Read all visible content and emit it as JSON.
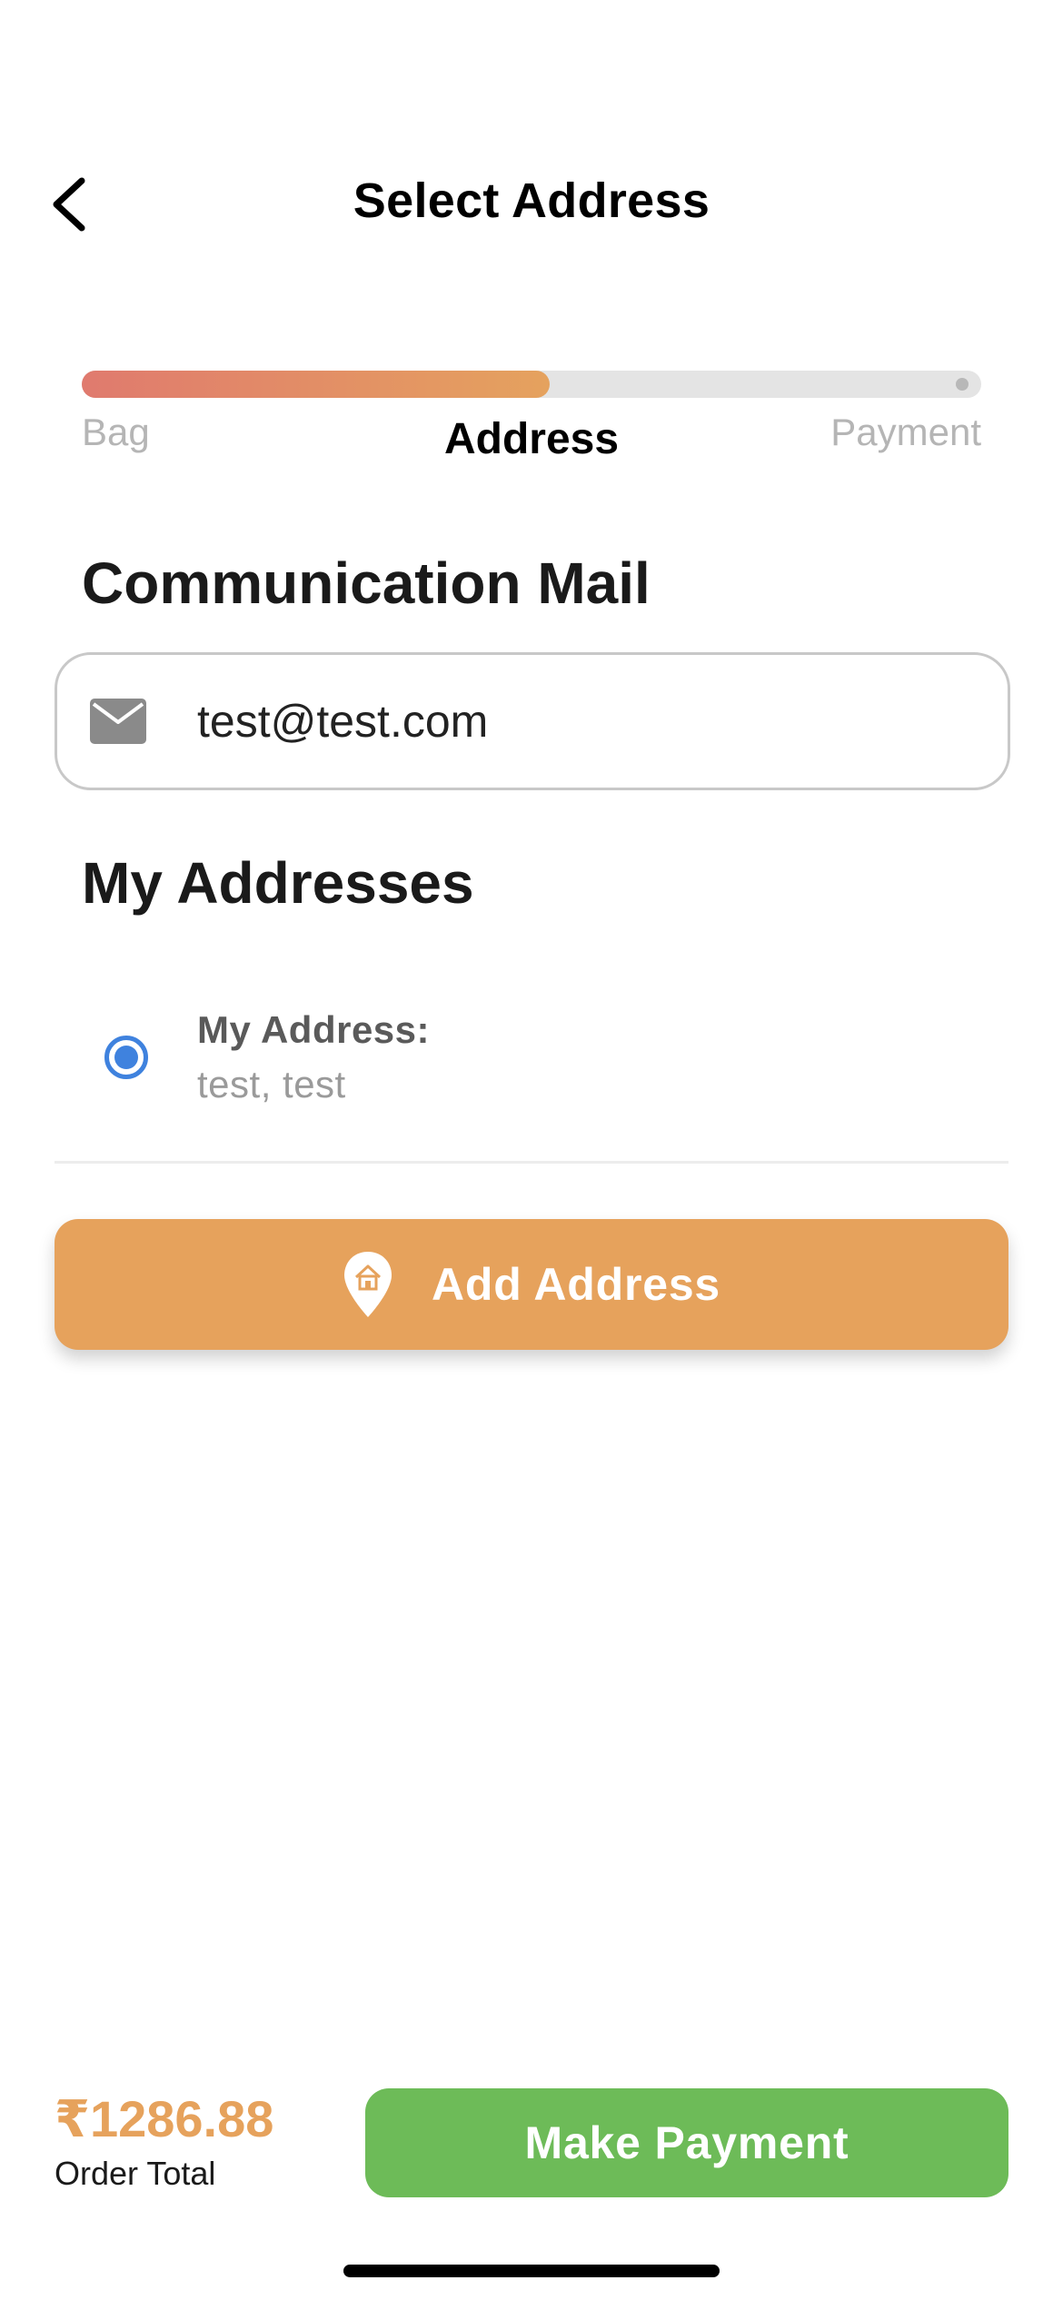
{
  "header": {
    "title": "Select Address",
    "back_icon": "chevron-left-icon"
  },
  "progress": {
    "fraction": 0.52,
    "steps": [
      "Bag",
      "Address",
      "Payment"
    ],
    "active_step": "Address",
    "gradient_start": "#e07a6e",
    "gradient_end": "#e5a25e"
  },
  "communication": {
    "title": "Communication Mail",
    "email_icon": "mail-icon",
    "email_value": "test@test.com"
  },
  "addresses": {
    "title": "My Addresses",
    "items": [
      {
        "label": "My Address:",
        "value": "test, test",
        "selected": true
      }
    ]
  },
  "add_address": {
    "label": "Add Address",
    "icon": "home-pin-icon",
    "color": "#e6a25c"
  },
  "footer": {
    "order_total_amount": "₹1286.88",
    "order_total_label": "Order Total",
    "pay_label": "Make Payment",
    "pay_color": "#6dbb58"
  }
}
